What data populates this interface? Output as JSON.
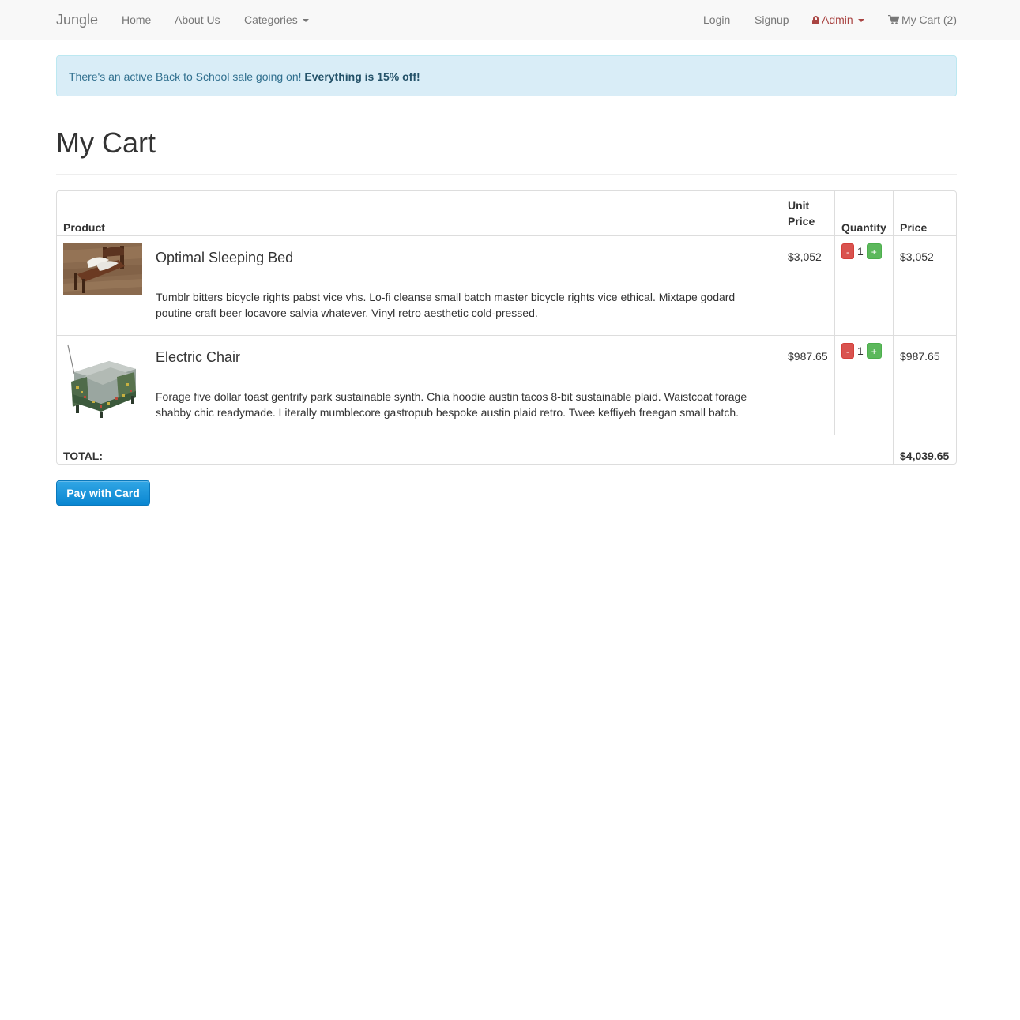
{
  "navbar": {
    "brand": "Jungle",
    "home": "Home",
    "about": "About Us",
    "categories": "Categories",
    "login": "Login",
    "signup": "Signup",
    "admin": "Admin",
    "cart": "My Cart (2)"
  },
  "alert": {
    "text": "There's an active Back to School sale going on!",
    "emphasis": "Everything is 15% off!"
  },
  "page": {
    "title": "My Cart"
  },
  "table": {
    "headers": {
      "product": "Product",
      "unit_price_line1": "Unit",
      "unit_price_line2": "Price",
      "quantity": "Quantity",
      "price": "Price"
    },
    "rows": [
      {
        "name": "Optimal Sleeping Bed",
        "description": "Tumblr bitters bicycle rights pabst vice vhs. Lo-fi cleanse small batch master bicycle rights vice ethical. Mixtape godard poutine craft beer locavore salvia whatever. Vinyl retro aesthetic cold-pressed.",
        "unit_price": "$3,052",
        "quantity": "1",
        "price": "$3,052",
        "image": "bed-photo"
      },
      {
        "name": "Electric Chair",
        "description": "Forage five dollar toast gentrify park sustainable synth. Chia hoodie austin tacos 8-bit sustainable plaid. Waistcoat forage shabby chic readymade. Literally mumblecore gastropub bespoke austin plaid retro. Twee keffiyeh freegan small batch.",
        "unit_price": "$987.65",
        "quantity": "1",
        "price": "$987.65",
        "image": "chair-photo"
      }
    ],
    "minus_label": "-",
    "plus_label": "+",
    "total_label": "TOTAL:",
    "total_value": "$4,039.65"
  },
  "pay_button": "Pay with Card",
  "colors": {
    "navbar_bg": "#f8f8f8",
    "alert_bg": "#d9edf7",
    "alert_text": "#31708f",
    "admin": "#a94442",
    "minus": "#d9534f",
    "plus": "#5cb85c",
    "pay": "#1a8fd8"
  }
}
